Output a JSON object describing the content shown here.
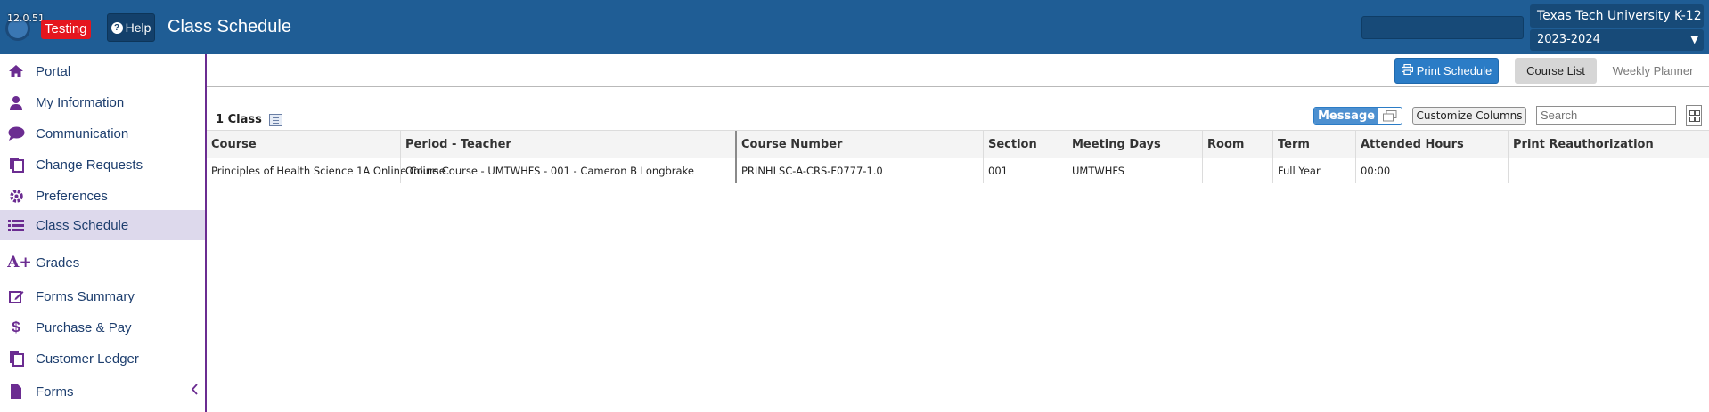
{
  "header": {
    "version": "12.0.51",
    "testing_label": "Testing",
    "help_label": "Help",
    "page_title": "Class Schedule",
    "district": "Texas Tech University K-12",
    "school_year": "2023-2024"
  },
  "sidebar": {
    "items": [
      {
        "label": "Portal",
        "icon": "home-icon"
      },
      {
        "label": "My Information",
        "icon": "user-icon"
      },
      {
        "label": "Communication",
        "icon": "chat-bubble-icon"
      },
      {
        "label": "Change Requests",
        "icon": "documents-icon"
      },
      {
        "label": "Preferences",
        "icon": "gear-icon"
      },
      {
        "label": "Class Schedule",
        "icon": "list-icon",
        "active": true
      },
      {
        "label": "Grades",
        "icon": "a-plus-icon"
      },
      {
        "label": "Forms Summary",
        "icon": "edit-icon"
      },
      {
        "label": "Purchase & Pay",
        "icon": "dollar-icon"
      },
      {
        "label": "Customer Ledger",
        "icon": "documents-icon"
      },
      {
        "label": "Forms",
        "icon": "file-icon"
      }
    ]
  },
  "toolbar": {
    "print_label": "Print Schedule",
    "course_list_label": "Course List",
    "weekly_planner_label": "Weekly Planner",
    "class_count": "1 Class",
    "message_label": "Message",
    "customize_label": "Customize Columns",
    "search_placeholder": "Search"
  },
  "table": {
    "columns": [
      "Course",
      "Period - Teacher",
      "Course Number",
      "Section",
      "Meeting Days",
      "Room",
      "Term",
      "Attended Hours",
      "Print Reauthorization"
    ],
    "rows": [
      [
        "Principles of Health Science 1A Online Course",
        "Online Course - UMTWHFS - 001 - Cameron B Longbrake",
        "PRINHLSC-A-CRS-F0777-1.0",
        "001",
        "UMTWHFS",
        "",
        "Full Year",
        "00:00",
        ""
      ]
    ]
  },
  "colors": {
    "header_bg": "#1f5d95",
    "accent_purple": "#6b2c91",
    "active_nav_bg": "#ddd9ec",
    "print_button": "#2b7cc6",
    "testing_badge": "#e5161e"
  }
}
